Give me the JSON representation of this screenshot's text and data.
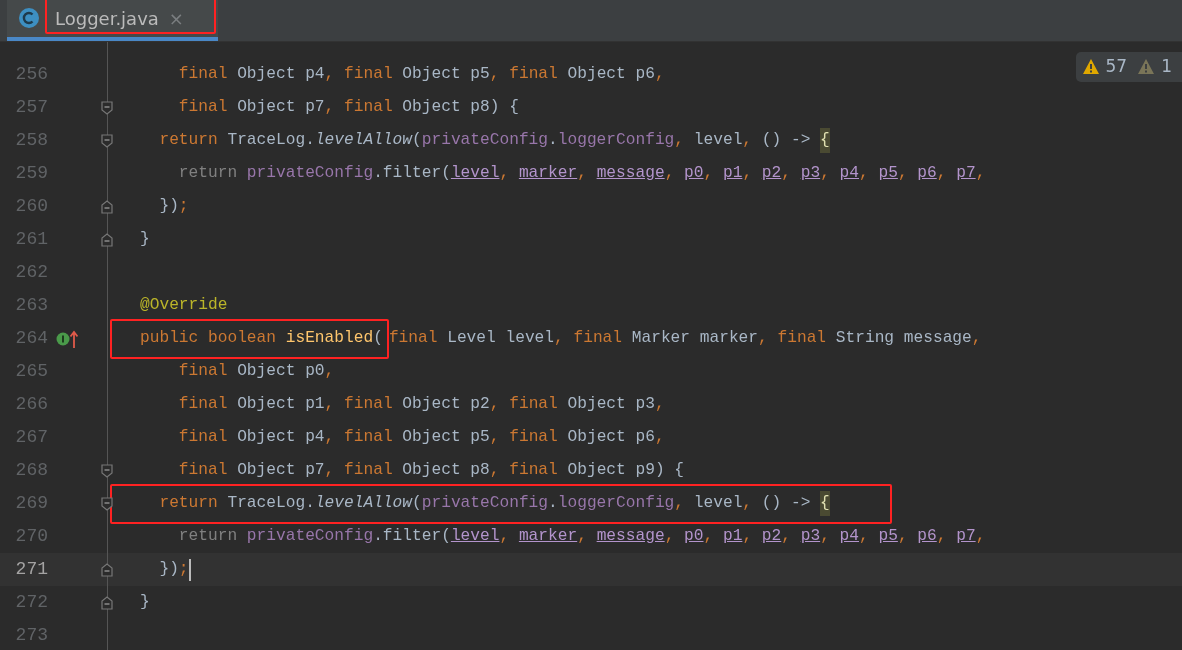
{
  "tab": {
    "label": "Logger.java",
    "close": "×",
    "selected": true,
    "annotated": true
  },
  "inspections": [
    {
      "kind": "warning",
      "count": "57"
    },
    {
      "kind": "weak-warning",
      "count": "1"
    }
  ],
  "lines": [
    {
      "number": "256",
      "kind": "plain",
      "current": false,
      "tokens": [
        {
          "kind": "kw",
          "text": "    final"
        },
        {
          "kind": "plain",
          "text": " Object p4"
        },
        {
          "kind": "punct",
          "text": ", "
        },
        {
          "kind": "kw",
          "text": "final"
        },
        {
          "kind": "plain",
          "text": " Object p5"
        },
        {
          "kind": "punct",
          "text": ", "
        },
        {
          "kind": "kw",
          "text": "final"
        },
        {
          "kind": "plain",
          "text": " Object p6"
        },
        {
          "kind": "punct",
          "text": ","
        }
      ]
    },
    {
      "number": "257",
      "kind": "fold-start",
      "current": false,
      "tokens": [
        {
          "kind": "kw",
          "text": "    final"
        },
        {
          "kind": "plain",
          "text": " Object p7"
        },
        {
          "kind": "punct",
          "text": ", "
        },
        {
          "kind": "kw",
          "text": "final"
        },
        {
          "kind": "plain",
          "text": " Object p8) {"
        }
      ]
    },
    {
      "number": "258",
      "kind": "fold-start",
      "current": false,
      "tokens": [
        {
          "kind": "kw",
          "text": "  return"
        },
        {
          "kind": "plain",
          "text": " TraceLog."
        },
        {
          "kind": "static",
          "text": "levelAllow"
        },
        {
          "kind": "plain",
          "text": "("
        },
        {
          "kind": "field",
          "text": "privateConfig"
        },
        {
          "kind": "plain",
          "text": "."
        },
        {
          "kind": "field",
          "text": "loggerConfig"
        },
        {
          "kind": "punct",
          "text": ", "
        },
        {
          "kind": "plain",
          "text": "level"
        },
        {
          "kind": "punct",
          "text": ", "
        },
        {
          "kind": "plain",
          "text": "() -> "
        },
        {
          "kind": "match",
          "text": "{"
        }
      ]
    },
    {
      "number": "259",
      "kind": "plain",
      "current": false,
      "tokens": [
        {
          "kind": "muted",
          "text": "    return "
        },
        {
          "kind": "field",
          "text": "privateConfig"
        },
        {
          "kind": "plain",
          "text": ".filter("
        },
        {
          "kind": "param",
          "text": "level"
        },
        {
          "kind": "punct",
          "text": ", "
        },
        {
          "kind": "param",
          "text": "marker"
        },
        {
          "kind": "punct",
          "text": ", "
        },
        {
          "kind": "param",
          "text": "message"
        },
        {
          "kind": "punct",
          "text": ", "
        },
        {
          "kind": "param",
          "text": "p0"
        },
        {
          "kind": "punct",
          "text": ", "
        },
        {
          "kind": "param",
          "text": "p1"
        },
        {
          "kind": "punct",
          "text": ", "
        },
        {
          "kind": "param",
          "text": "p2"
        },
        {
          "kind": "punct",
          "text": ", "
        },
        {
          "kind": "param",
          "text": "p3"
        },
        {
          "kind": "punct",
          "text": ", "
        },
        {
          "kind": "param",
          "text": "p4"
        },
        {
          "kind": "punct",
          "text": ", "
        },
        {
          "kind": "param",
          "text": "p5"
        },
        {
          "kind": "punct",
          "text": ", "
        },
        {
          "kind": "param",
          "text": "p6"
        },
        {
          "kind": "punct",
          "text": ", "
        },
        {
          "kind": "param",
          "text": "p7"
        },
        {
          "kind": "punct",
          "text": ","
        }
      ]
    },
    {
      "number": "260",
      "kind": "fold-end",
      "current": false,
      "tokens": [
        {
          "kind": "plain",
          "text": "  })"
        },
        {
          "kind": "punct",
          "text": ";"
        }
      ]
    },
    {
      "number": "261",
      "kind": "fold-end",
      "current": false,
      "tokens": [
        {
          "kind": "plain",
          "text": "}"
        }
      ]
    },
    {
      "number": "262",
      "kind": "plain",
      "current": false
    },
    {
      "number": "263",
      "kind": "plain",
      "current": false,
      "tokens": [
        {
          "kind": "annot",
          "text": "@Override"
        }
      ]
    },
    {
      "number": "264",
      "kind": "implements",
      "current": false,
      "boxed_tokens": [
        {
          "kind": "kw",
          "text": "public boolean "
        },
        {
          "kind": "decl",
          "text": "isEnabled"
        },
        {
          "kind": "plain",
          "text": "("
        }
      ],
      "tokens": [
        {
          "kind": "kw",
          "text": "final"
        },
        {
          "kind": "plain",
          "text": " Level level"
        },
        {
          "kind": "punct",
          "text": ", "
        },
        {
          "kind": "kw",
          "text": "final"
        },
        {
          "kind": "plain",
          "text": " Marker marker"
        },
        {
          "kind": "punct",
          "text": ", "
        },
        {
          "kind": "kw",
          "text": "final"
        },
        {
          "kind": "plain",
          "text": " String message"
        },
        {
          "kind": "punct",
          "text": ","
        }
      ]
    },
    {
      "number": "265",
      "kind": "plain",
      "current": false,
      "tokens": [
        {
          "kind": "kw",
          "text": "    final"
        },
        {
          "kind": "plain",
          "text": " Object p0"
        },
        {
          "kind": "punct",
          "text": ","
        }
      ]
    },
    {
      "number": "266",
      "kind": "plain",
      "current": false,
      "tokens": [
        {
          "kind": "kw",
          "text": "    final"
        },
        {
          "kind": "plain",
          "text": " Object p1"
        },
        {
          "kind": "punct",
          "text": ", "
        },
        {
          "kind": "kw",
          "text": "final"
        },
        {
          "kind": "plain",
          "text": " Object p2"
        },
        {
          "kind": "punct",
          "text": ", "
        },
        {
          "kind": "kw",
          "text": "final"
        },
        {
          "kind": "plain",
          "text": " Object p3"
        },
        {
          "kind": "punct",
          "text": ","
        }
      ]
    },
    {
      "number": "267",
      "kind": "plain",
      "current": false,
      "tokens": [
        {
          "kind": "kw",
          "text": "    final"
        },
        {
          "kind": "plain",
          "text": " Object p4"
        },
        {
          "kind": "punct",
          "text": ", "
        },
        {
          "kind": "kw",
          "text": "final"
        },
        {
          "kind": "plain",
          "text": " Object p5"
        },
        {
          "kind": "punct",
          "text": ", "
        },
        {
          "kind": "kw",
          "text": "final"
        },
        {
          "kind": "plain",
          "text": " Object p6"
        },
        {
          "kind": "punct",
          "text": ","
        }
      ]
    },
    {
      "number": "268",
      "kind": "fold-start",
      "current": false,
      "tokens": [
        {
          "kind": "kw",
          "text": "    final"
        },
        {
          "kind": "plain",
          "text": " Object p7"
        },
        {
          "kind": "punct",
          "text": ", "
        },
        {
          "kind": "kw",
          "text": "final"
        },
        {
          "kind": "plain",
          "text": " Object p8"
        },
        {
          "kind": "punct",
          "text": ", "
        },
        {
          "kind": "kw",
          "text": "final"
        },
        {
          "kind": "plain",
          "text": " Object p9) {"
        }
      ]
    },
    {
      "number": "269",
      "kind": "fold-start",
      "current": false,
      "boxed_tokens": [
        {
          "kind": "kw",
          "text": "  return"
        },
        {
          "kind": "plain",
          "text": " TraceLog."
        },
        {
          "kind": "static",
          "text": "levelAllow"
        },
        {
          "kind": "plain",
          "text": "("
        },
        {
          "kind": "field",
          "text": "privateConfig"
        },
        {
          "kind": "plain",
          "text": "."
        },
        {
          "kind": "field",
          "text": "loggerConfig"
        },
        {
          "kind": "punct",
          "text": ", "
        },
        {
          "kind": "plain",
          "text": "level"
        },
        {
          "kind": "punct",
          "text": ", "
        },
        {
          "kind": "plain",
          "text": "() -> "
        },
        {
          "kind": "match",
          "text": "{"
        }
      ]
    },
    {
      "number": "270",
      "kind": "plain",
      "current": false,
      "tokens": [
        {
          "kind": "muted",
          "text": "    return "
        },
        {
          "kind": "field",
          "text": "privateConfig"
        },
        {
          "kind": "plain",
          "text": ".filter("
        },
        {
          "kind": "param",
          "text": "level"
        },
        {
          "kind": "punct",
          "text": ", "
        },
        {
          "kind": "param",
          "text": "marker"
        },
        {
          "kind": "punct",
          "text": ", "
        },
        {
          "kind": "param",
          "text": "message"
        },
        {
          "kind": "punct",
          "text": ", "
        },
        {
          "kind": "param",
          "text": "p0"
        },
        {
          "kind": "punct",
          "text": ", "
        },
        {
          "kind": "param",
          "text": "p1"
        },
        {
          "kind": "punct",
          "text": ", "
        },
        {
          "kind": "param",
          "text": "p2"
        },
        {
          "kind": "punct",
          "text": ", "
        },
        {
          "kind": "param",
          "text": "p3"
        },
        {
          "kind": "punct",
          "text": ", "
        },
        {
          "kind": "param",
          "text": "p4"
        },
        {
          "kind": "punct",
          "text": ", "
        },
        {
          "kind": "param",
          "text": "p5"
        },
        {
          "kind": "punct",
          "text": ", "
        },
        {
          "kind": "param",
          "text": "p6"
        },
        {
          "kind": "punct",
          "text": ", "
        },
        {
          "kind": "param",
          "text": "p7"
        },
        {
          "kind": "punct",
          "text": ","
        }
      ]
    },
    {
      "number": "271",
      "kind": "fold-end",
      "current": true,
      "tokens": [
        {
          "kind": "plain",
          "text": "  })"
        },
        {
          "kind": "punct",
          "text": ";"
        }
      ]
    },
    {
      "number": "272",
      "kind": "fold-end",
      "current": false,
      "tokens": [
        {
          "kind": "plain",
          "text": "}"
        }
      ]
    },
    {
      "number": "273",
      "kind": "plain",
      "current": false
    }
  ]
}
